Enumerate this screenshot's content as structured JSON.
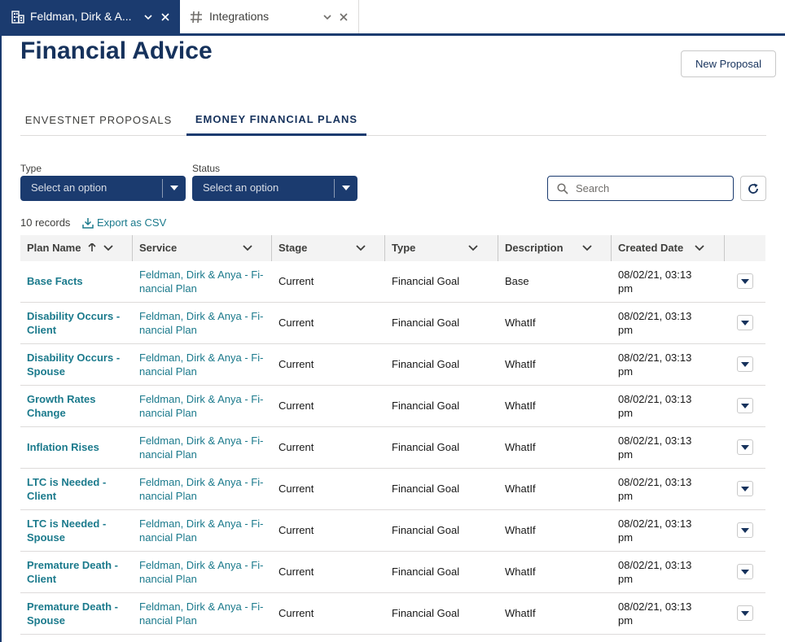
{
  "tabs": [
    {
      "label": "Feldman, Dirk & A...",
      "icon": "building-icon"
    },
    {
      "label": "Integrations",
      "icon": "hash-icon"
    }
  ],
  "page": {
    "title": "Financial Advice",
    "new_proposal_label": "New Proposal"
  },
  "content_tabs": [
    "ENVESTNET PROPOSALS",
    "EMONEY FINANCIAL PLANS"
  ],
  "filters": {
    "type_label": "Type",
    "type_value": "Select an option",
    "status_label": "Status",
    "status_value": "Select an option",
    "search_placeholder": "Search"
  },
  "records_count": "10 records",
  "export_label": "Export as CSV",
  "colors": {
    "brand_navy": "#1b3b6f",
    "link_teal": "#1b7a8c"
  },
  "table": {
    "columns": [
      "Plan Name",
      "Service",
      "Stage",
      "Type",
      "Description",
      "Created Date"
    ],
    "rows": [
      {
        "plan_l1": "Base Facts",
        "plan_l2": "",
        "service_l1": "Feldman, Dirk & Anya - Fi-",
        "service_l2": "nancial Plan",
        "stage": "Current",
        "type": "Financial Goal",
        "description": "Base",
        "created_l1": "08/02/21, 03:13",
        "created_l2": "pm"
      },
      {
        "plan_l1": "Disability Occurs -",
        "plan_l2": "Client",
        "service_l1": "Feldman, Dirk & Anya - Fi-",
        "service_l2": "nancial Plan",
        "stage": "Current",
        "type": "Financial Goal",
        "description": "WhatIf",
        "created_l1": "08/02/21, 03:13",
        "created_l2": "pm"
      },
      {
        "plan_l1": "Disability Occurs -",
        "plan_l2": "Spouse",
        "service_l1": "Feldman, Dirk & Anya - Fi-",
        "service_l2": "nancial Plan",
        "stage": "Current",
        "type": "Financial Goal",
        "description": "WhatIf",
        "created_l1": "08/02/21, 03:13",
        "created_l2": "pm"
      },
      {
        "plan_l1": "Growth Rates",
        "plan_l2": "Change",
        "service_l1": "Feldman, Dirk & Anya - Fi-",
        "service_l2": "nancial Plan",
        "stage": "Current",
        "type": "Financial Goal",
        "description": "WhatIf",
        "created_l1": "08/02/21, 03:13",
        "created_l2": "pm"
      },
      {
        "plan_l1": "Inflation Rises",
        "plan_l2": "",
        "service_l1": "Feldman, Dirk & Anya - Fi-",
        "service_l2": "nancial Plan",
        "stage": "Current",
        "type": "Financial Goal",
        "description": "WhatIf",
        "created_l1": "08/02/21, 03:13",
        "created_l2": "pm"
      },
      {
        "plan_l1": "LTC is Needed -",
        "plan_l2": "Client",
        "service_l1": "Feldman, Dirk & Anya - Fi-",
        "service_l2": "nancial Plan",
        "stage": "Current",
        "type": "Financial Goal",
        "description": "WhatIf",
        "created_l1": "08/02/21, 03:13",
        "created_l2": "pm"
      },
      {
        "plan_l1": "LTC is Needed -",
        "plan_l2": "Spouse",
        "service_l1": "Feldman, Dirk & Anya - Fi-",
        "service_l2": "nancial Plan",
        "stage": "Current",
        "type": "Financial Goal",
        "description": "WhatIf",
        "created_l1": "08/02/21, 03:13",
        "created_l2": "pm"
      },
      {
        "plan_l1": "Premature Death -",
        "plan_l2": "Client",
        "service_l1": "Feldman, Dirk & Anya - Fi-",
        "service_l2": "nancial Plan",
        "stage": "Current",
        "type": "Financial Goal",
        "description": "WhatIf",
        "created_l1": "08/02/21, 03:13",
        "created_l2": "pm"
      },
      {
        "plan_l1": "Premature Death -",
        "plan_l2": "Spouse",
        "service_l1": "Feldman, Dirk & Anya - Fi-",
        "service_l2": "nancial Plan",
        "stage": "Current",
        "type": "Financial Goal",
        "description": "WhatIf",
        "created_l1": "08/02/21, 03:13",
        "created_l2": "pm"
      }
    ]
  }
}
